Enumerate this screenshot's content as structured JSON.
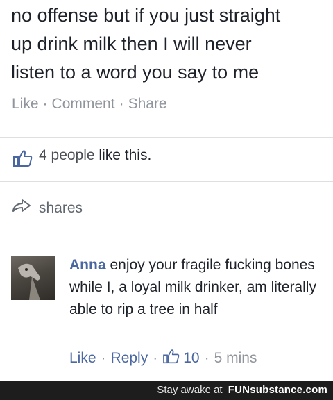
{
  "post": {
    "text": "no offense but if you just straight\nup drink milk then I will never\nlisten to a word you say to me",
    "actions": {
      "like": "Like",
      "comment": "Comment",
      "share": "Share",
      "separator": "·"
    }
  },
  "likes": {
    "count_text": "4 people",
    "suffix": "like this."
  },
  "shares": {
    "label": "shares"
  },
  "comment": {
    "author": "Anna",
    "text": "enjoy your fragile fucking bones while I, a loyal milk drinker, am literally able to rip a tree in half",
    "like": "Like",
    "reply": "Reply",
    "reaction_count": "10",
    "time": "5 mins",
    "separator": "·"
  },
  "footer": {
    "tagline": "Stay awake at",
    "brand": "FUNsubstance.com"
  },
  "colors": {
    "link_blue": "#4b67a1",
    "meta_gray": "#90949c",
    "text": "#1d2129",
    "divider": "#dddfe2"
  }
}
